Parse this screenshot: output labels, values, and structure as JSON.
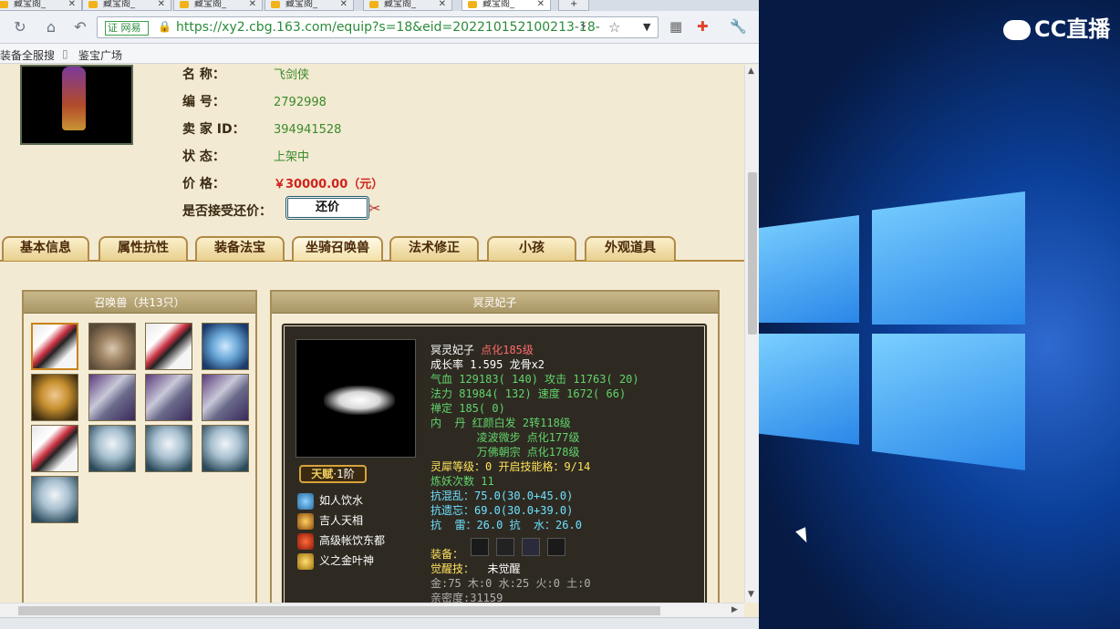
{
  "browser": {
    "tabs": [
      {
        "label": "藏宝阁_"
      },
      {
        "label": "藏宝阁_"
      },
      {
        "label": "藏宝阁_"
      },
      {
        "label": "藏宝阁_"
      },
      {
        "label": "藏宝阁_"
      },
      {
        "label": "藏宝阁_"
      }
    ],
    "new_tab": "+",
    "cert_label": "证 网易",
    "url": "https://xy2.cbg.163.com/equip?s=18&eid=202210152100213-18-",
    "bookmarks": [
      "装备全服搜",
      "鉴宝广场"
    ]
  },
  "role": {
    "fields": [
      {
        "label": "名        称：",
        "value": "飞剑侠"
      },
      {
        "label": "编        号：",
        "value": "2792998"
      },
      {
        "label": "卖 家   ID：",
        "value": "394941528"
      },
      {
        "label": "状        态：",
        "value": "上架中"
      },
      {
        "label": "价        格：",
        "value": "￥30000.00（元）"
      }
    ],
    "haggle_label": "是否接受还价：",
    "haggle_button": "还价"
  },
  "page_tabs": [
    "基本信息",
    "属性抗性",
    "装备法宝",
    "坐骑召唤兽",
    "法术修正",
    "小孩",
    "外观道具"
  ],
  "pet_list": {
    "header": "召唤兽（共13只）",
    "pets": [
      "fairy",
      "squirrel",
      "fairy",
      "ice",
      "king",
      "wolf",
      "wolf",
      "wolf",
      "fairy",
      "ghost",
      "ghost",
      "ghost",
      "ghost"
    ]
  },
  "detail": {
    "header": "冥灵妃子",
    "talent_label": "天赋",
    "talent_level": "·1阶",
    "skills": [
      "如人饮水",
      "吉人天相",
      "高级帐饮东都",
      "义之金叶神"
    ],
    "stats": {
      "line1_name": "冥灵妃子 ",
      "line1_lv": "点化185级",
      "line2": "成长率 1.595 龙骨x2",
      "line3a": "气血 129183( 140) ",
      "line3b": "攻击 11763( 20)",
      "line4a": "法力 81984( 132) ",
      "line4b": "速度 1672( 66)",
      "line5": "禅定 185( 0)",
      "line6": "内  丹 红颜白发 2转118级",
      "line7": "       凌波微步 点化177级",
      "line8": "       万佛朝宗 点化178级",
      "line9": "灵犀等级：0 开启技能格：9/14",
      "line10": "炼妖次数 11",
      "line11": "抗混乱：75.0(30.0+45.0)",
      "line12": "抗遗忘：69.0(30.0+39.0)",
      "line13": "抗  雷：26.0 抗  水：26.0",
      "line14": " ",
      "line15": "装备：",
      "line16a": "觉醒技：",
      "line16b": "  未觉醒",
      "line17": "金:75 木:0 水:25 火:0 土:0",
      "line18": "亲密度:31159"
    }
  },
  "overlay": {
    "logo": "CC直播"
  }
}
